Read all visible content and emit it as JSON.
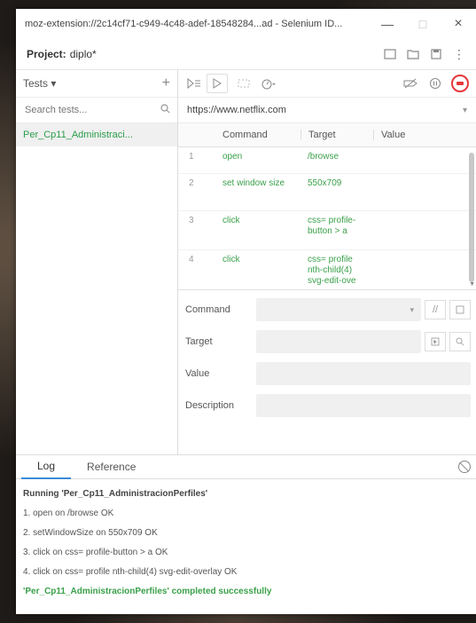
{
  "window": {
    "title": "moz-extension://2c14cf71-c949-4c48-adef-18548284...ad - Selenium ID...",
    "minimize": "—",
    "maximize": "□",
    "close": "×"
  },
  "project": {
    "label": "Project:",
    "name": "diplo*"
  },
  "tests_panel": {
    "dropdown_label": "Tests ▾",
    "add_label": "+",
    "search_placeholder": "Search tests...",
    "items": [
      {
        "label": "Per_Cp11_Administraci..."
      }
    ]
  },
  "url": "https://www.netflix.com",
  "table": {
    "headers": {
      "command": "Command",
      "target": "Target",
      "value": "Value"
    },
    "rows": [
      {
        "num": "1",
        "command": "open",
        "target": "/browse",
        "value": ""
      },
      {
        "num": "2",
        "command": "set window size",
        "target": "550x709",
        "value": ""
      },
      {
        "num": "3",
        "command": "click",
        "target": "css= profile-button > a",
        "value": ""
      },
      {
        "num": "4",
        "command": "click",
        "target": "css= profile nth-child(4) svg-edit-ove",
        "value": ""
      }
    ]
  },
  "editor": {
    "command_label": "Command",
    "target_label": "Target",
    "value_label": "Value",
    "description_label": "Description"
  },
  "log": {
    "tabs": [
      "Log",
      "Reference"
    ],
    "lines": [
      {
        "text": "Running 'Per_Cp11_AdministracionPerfiles'",
        "style": "bold"
      },
      {
        "text": "1.  open on /browse OK",
        "style": "normal"
      },
      {
        "text": "2.  setWindowSize on 550x709 OK",
        "style": "normal"
      },
      {
        "text": "3.  click on css= profile-button > a OK",
        "style": "normal"
      },
      {
        "text": "4.  click on css= profile nth-child(4) svg-edit-overlay OK",
        "style": "normal"
      },
      {
        "text": "'Per_Cp11_AdministracionPerfiles' completed successfully",
        "style": "success"
      }
    ]
  },
  "colors": {
    "accent": "#3aa04a",
    "record": "#e5383b",
    "tab_active": "#3a8bd8"
  }
}
